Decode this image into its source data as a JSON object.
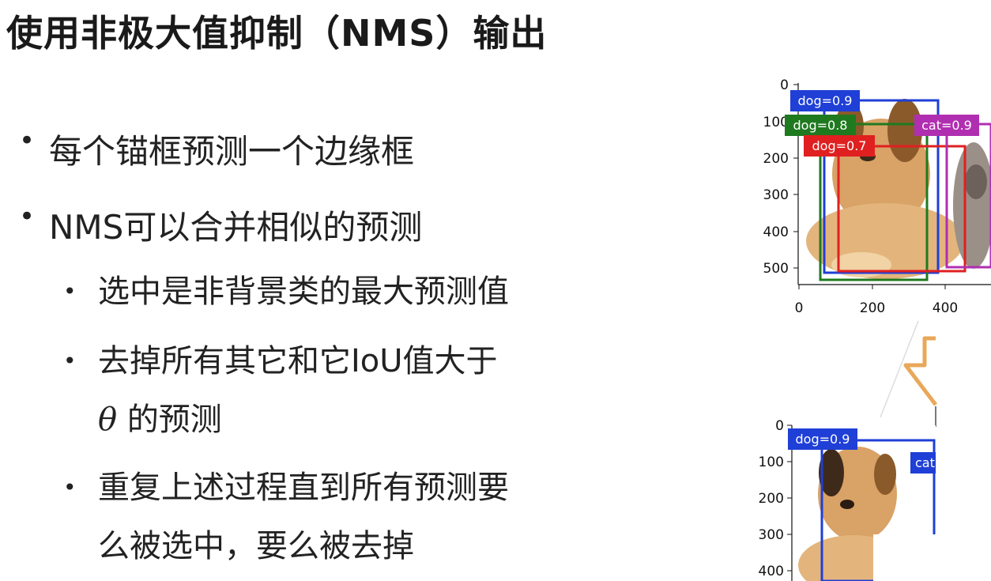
{
  "slide": {
    "title": "使用非极大值抑制（NMS）输出",
    "bullets": [
      {
        "text": "每个锚框预测一个边缘框"
      },
      {
        "text": "NMS可以合并相似的预测"
      }
    ],
    "sub_bullets": [
      {
        "line1": "选中是非背景类的最大预测值"
      },
      {
        "line1": "去掉所有其它和它IoU值大于",
        "symbol": "θ",
        "line2_rest": "的预测"
      },
      {
        "line1": "重复上述过程直到所有预测要",
        "line2": "么被选中，要么被去掉"
      }
    ]
  },
  "figure_top": {
    "y_ticks": [
      "0",
      "100",
      "200",
      "300",
      "400",
      "500"
    ],
    "x_ticks": [
      "0",
      "200",
      "400"
    ],
    "boxes": [
      {
        "label": "dog=0.9",
        "color": "#1f3fd6"
      },
      {
        "label": "dog=0.8",
        "color": "#1f7a1f"
      },
      {
        "label": "dog=0.7",
        "color": "#e02020"
      },
      {
        "label": "cat=0.9",
        "color": "#b02fb0"
      }
    ]
  },
  "figure_bottom": {
    "y_ticks": [
      "0",
      "100",
      "200",
      "300",
      "400"
    ],
    "boxes": [
      {
        "label": "dog=0.9",
        "color": "#1f3fd6"
      },
      {
        "label": "cat",
        "color": "#1f3fd6"
      }
    ]
  },
  "colors": {
    "arrow": "#e8a85a"
  }
}
